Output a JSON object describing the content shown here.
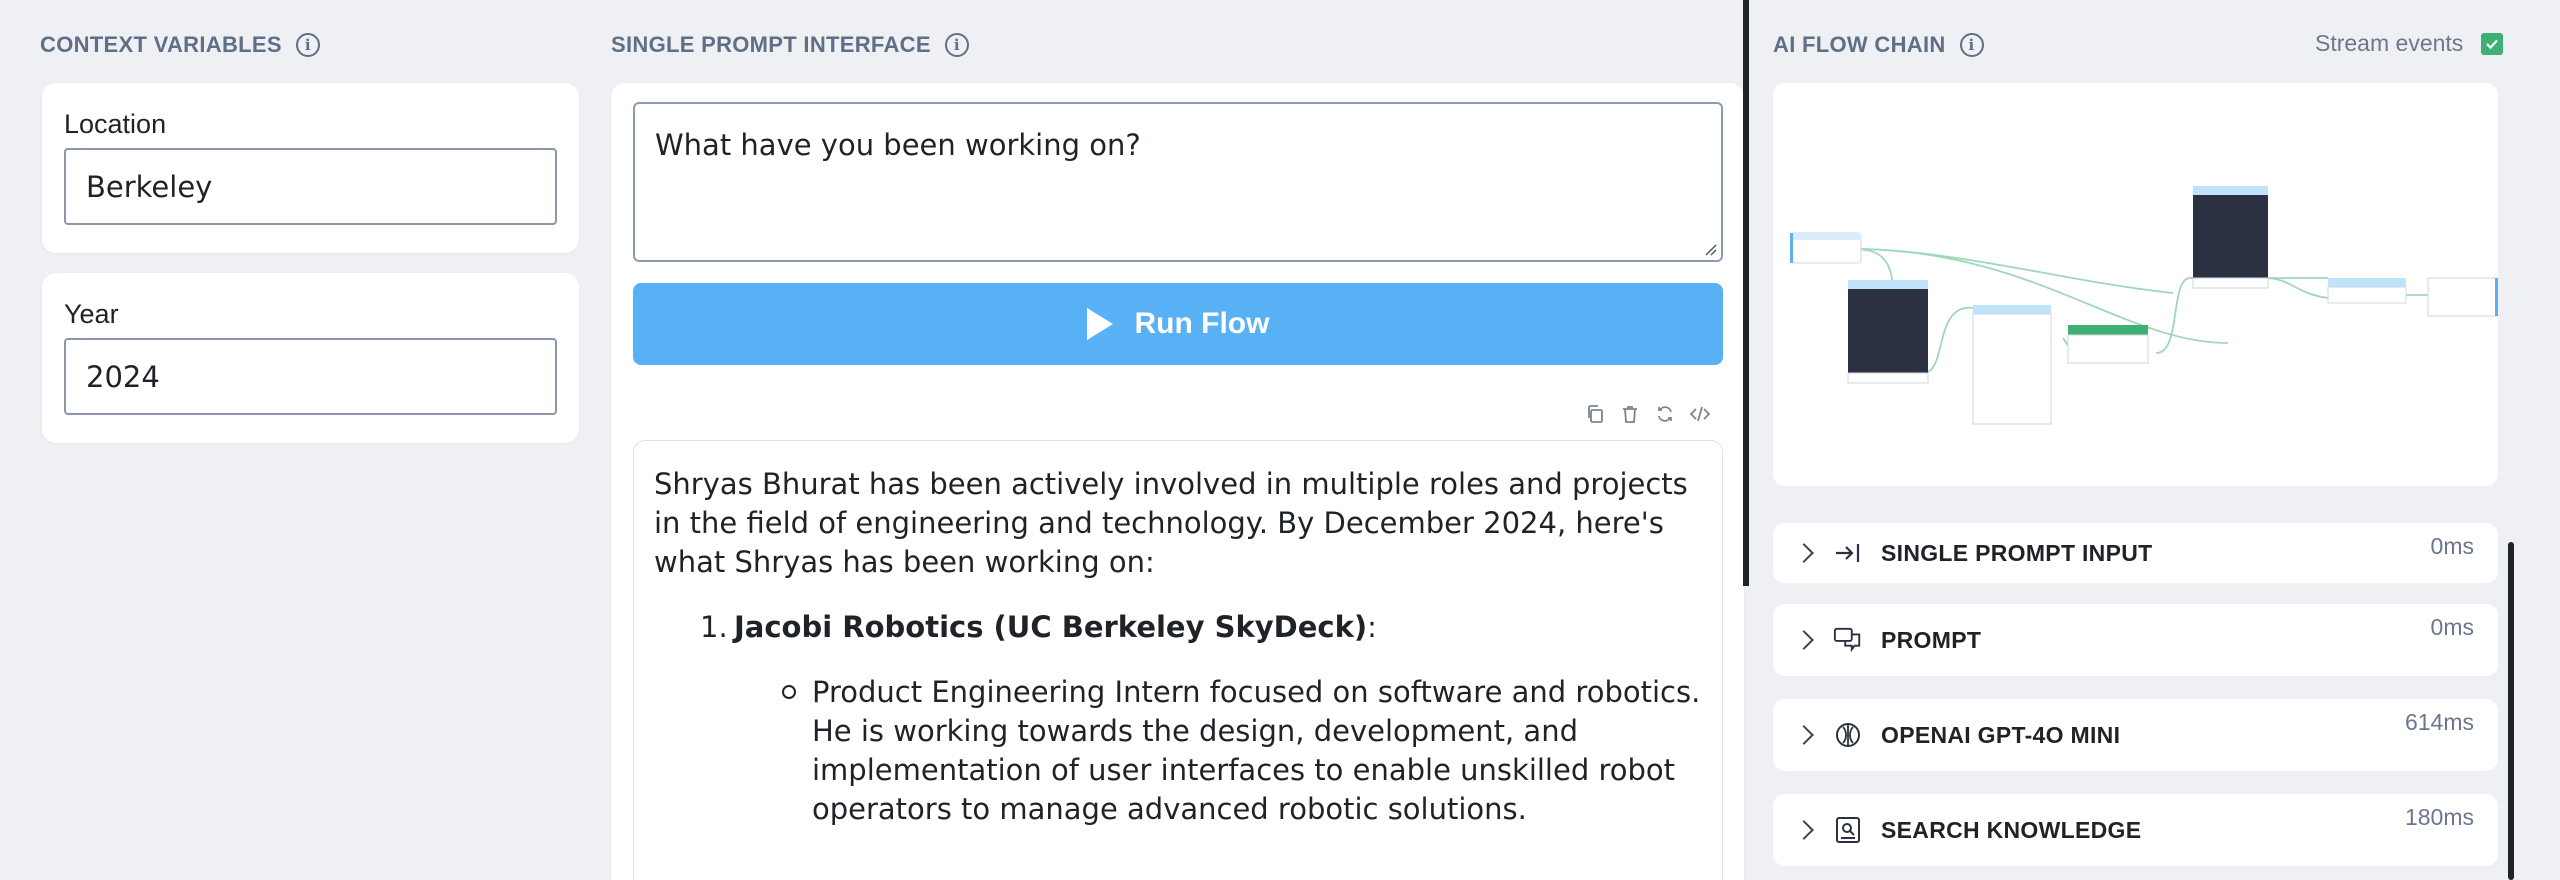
{
  "context_variables": {
    "title": "CONTEXT VARIABLES",
    "fields": [
      {
        "label": "Location",
        "value": "Berkeley"
      },
      {
        "label": "Year",
        "value": "2024"
      }
    ]
  },
  "single_prompt": {
    "title": "SINGLE PROMPT INTERFACE",
    "prompt_value": "What have you been working on?",
    "run_button_label": "Run Flow",
    "response": {
      "intro": "Shryas Bhurat has been actively involved in multiple roles and projects in the field of engineering and technology. By December 2024, here's what Shryas has been working on:",
      "items": [
        {
          "number": "1.",
          "heading": "Jacobi Robotics (UC Berkeley SkyDeck)",
          "suffix": ":",
          "bullet": "Product Engineering Intern focused on software and robotics. He is working towards the design, development, and implementation of user interfaces to enable unskilled robot operators to manage advanced robotic solutions."
        }
      ]
    }
  },
  "ai_flow_chain": {
    "title": "AI FLOW CHAIN",
    "stream_events_label": "Stream events",
    "stream_events_checked": true,
    "steps": [
      {
        "label": "SINGLE PROMPT INPUT",
        "time": "0ms",
        "icon": "input-arrow-icon"
      },
      {
        "label": "PROMPT",
        "time": "0ms",
        "icon": "chat-bubbles-icon"
      },
      {
        "label": "OPENAI GPT-4O MINI",
        "time": "614ms",
        "icon": "openai-icon"
      },
      {
        "label": "SEARCH KNOWLEDGE",
        "time": "180ms",
        "icon": "knowledge-book-icon"
      }
    ]
  },
  "colors": {
    "background": "#eef0f4",
    "accent": "#58b1f5",
    "section_title": "#5f6f86",
    "checkbox": "#3fb073"
  }
}
